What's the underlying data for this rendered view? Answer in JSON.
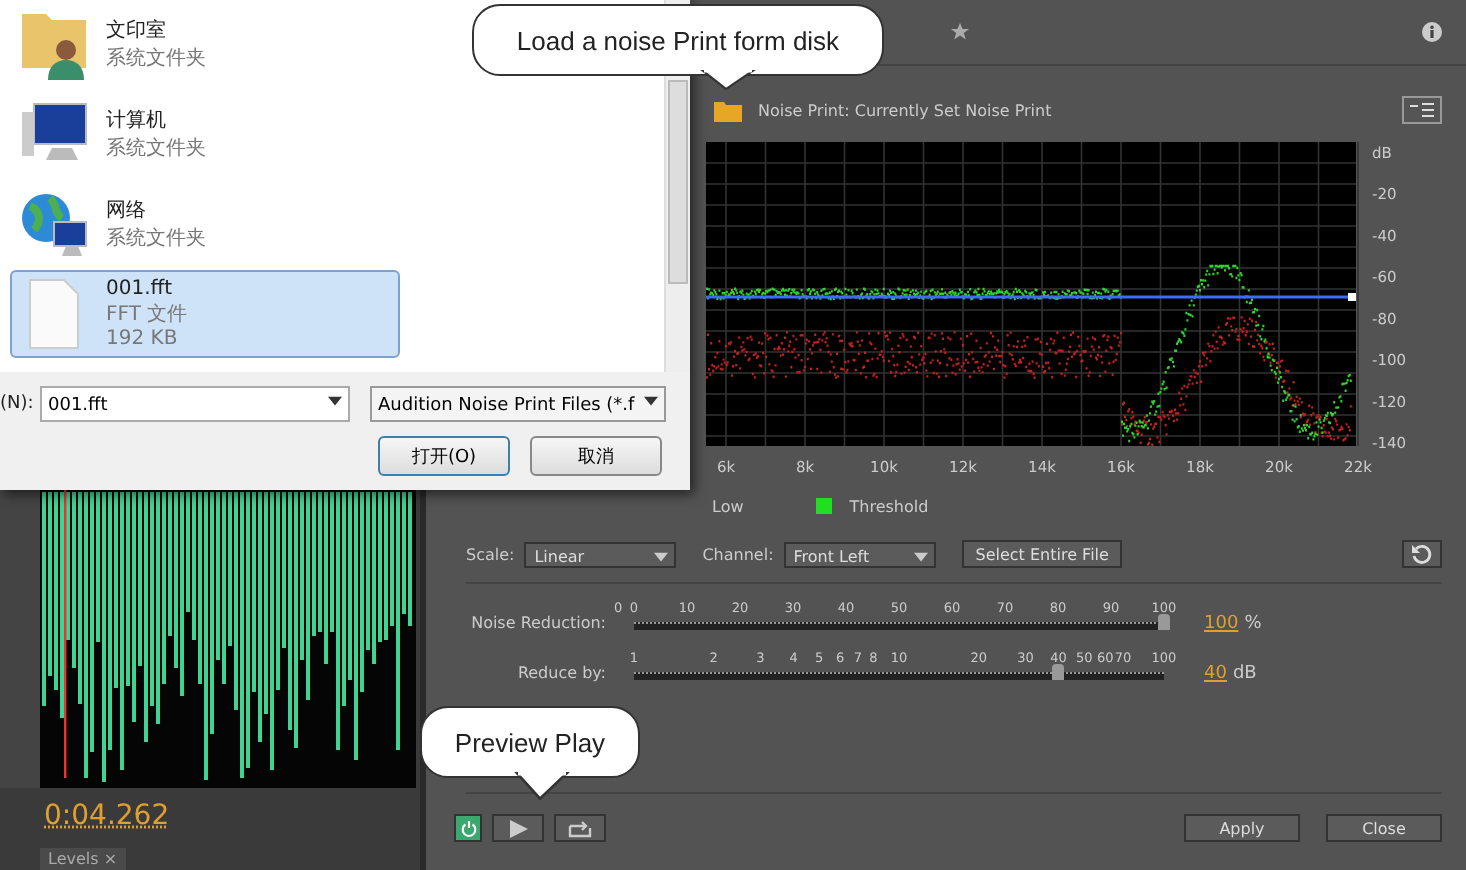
{
  "editor": {
    "time": "0:04.262",
    "panel_tab": "Levels",
    "panel_tab_close": "×"
  },
  "effect": {
    "noise_print": "Noise Print: Currently Set Noise Print",
    "spectrum": {
      "y_labels": [
        "dB",
        "-20",
        "-40",
        "-60",
        "-80",
        "-100",
        "-120",
        "-140"
      ],
      "x_labels": [
        "6k",
        "8k",
        "10k",
        "12k",
        "14k",
        "16k",
        "18k",
        "20k",
        "22k"
      ]
    },
    "legend": [
      {
        "label": "Low",
        "kind": "plain"
      },
      {
        "label": "Threshold",
        "kind": "swatch",
        "color": "#22dd22"
      }
    ],
    "scale_label": "Scale:",
    "scale": "Linear",
    "channel_label": "Channel:",
    "channel": "Front Left",
    "select_button": "Select Entire File",
    "sliders": [
      {
        "label": "Noise Reduction:",
        "ticks": [
          "0",
          "0",
          "10",
          "20",
          "30",
          "40",
          "50",
          "60",
          "70",
          "80",
          "90",
          "100"
        ],
        "level": 1,
        "value": "100",
        "unit": "%"
      },
      {
        "label": "Reduce by:",
        "ticks": [
          "1",
          "2",
          "3",
          "4",
          "5",
          "6",
          "7",
          "8",
          "10",
          "20",
          "30",
          "40",
          "50",
          "60",
          "70",
          "100"
        ],
        "level": 0.8,
        "value": "40",
        "unit": "dB"
      }
    ],
    "footer": {
      "power_on": true,
      "apply": "Apply",
      "close": "Close"
    }
  },
  "dialog": {
    "items": [
      {
        "name": "文印室",
        "type": "系统文件夹",
        "kind": "user-folder",
        "selected": false
      },
      {
        "name": "计算机",
        "type": "系统文件夹",
        "kind": "computer",
        "selected": false
      },
      {
        "name": "网络",
        "type": "系统文件夹",
        "kind": "network",
        "selected": false
      },
      {
        "name": "001.fft",
        "type": "FFT 文件",
        "size": "192 KB",
        "kind": "file",
        "selected": true
      }
    ],
    "filename_label": "(N):",
    "filename": "001.fft",
    "filter": "Audition Noise Print Files (*.f",
    "open_button": "打开(O)",
    "cancel_button": "取消"
  },
  "callouts": [
    {
      "text": "Load a noise Print form disk",
      "kind": "top"
    },
    {
      "text": "Preview Play",
      "kind": "bottom"
    }
  ]
}
